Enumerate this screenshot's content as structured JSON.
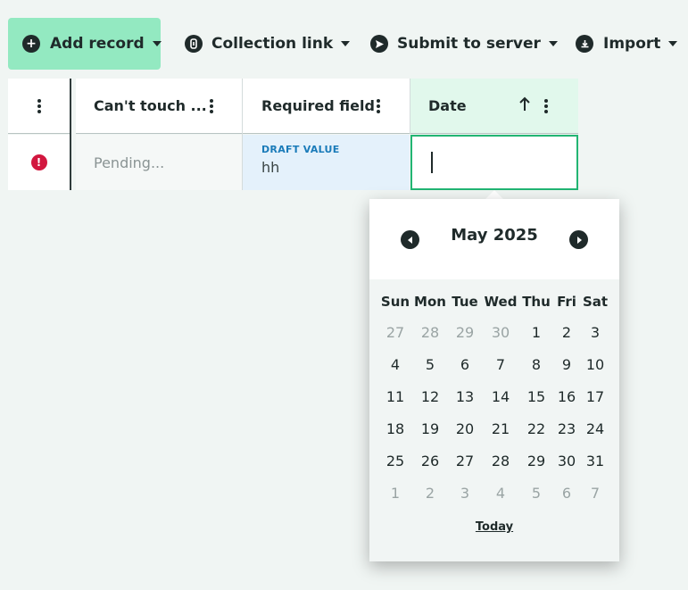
{
  "toolbar": {
    "add_record": {
      "label": "Add record",
      "icon": "plus-circle-icon"
    },
    "collection_link": {
      "label": "Collection link",
      "icon": "link-icon"
    },
    "submit": {
      "label": "Submit to server",
      "icon": "send-icon"
    },
    "import": {
      "label": "Import",
      "icon": "download-icon"
    }
  },
  "grid": {
    "columns": [
      {
        "label": "Can't touch ..."
      },
      {
        "label": "Required field"
      },
      {
        "label": "Date",
        "sort": "ascending"
      }
    ],
    "row": {
      "status_icon": "!",
      "cant_touch": "Pending...",
      "required": {
        "badge": "DRAFT VALUE",
        "value": "hh"
      },
      "date": {
        "value": ""
      }
    }
  },
  "calendar": {
    "month_label": "May 2025",
    "weekdays": [
      "Sun",
      "Mon",
      "Tue",
      "Wed",
      "Thu",
      "Fri",
      "Sat"
    ],
    "weeks": [
      [
        [
          "27",
          true
        ],
        [
          "28",
          true
        ],
        [
          "29",
          true
        ],
        [
          "30",
          true
        ],
        [
          "1",
          false
        ],
        [
          "2",
          false
        ],
        [
          "3",
          false
        ]
      ],
      [
        [
          "4",
          false
        ],
        [
          "5",
          false
        ],
        [
          "6",
          false
        ],
        [
          "7",
          false
        ],
        [
          "8",
          false
        ],
        [
          "9",
          false
        ],
        [
          "10",
          false
        ]
      ],
      [
        [
          "11",
          false
        ],
        [
          "12",
          false
        ],
        [
          "13",
          false
        ],
        [
          "14",
          false
        ],
        [
          "15",
          false
        ],
        [
          "16",
          false
        ],
        [
          "17",
          false
        ]
      ],
      [
        [
          "18",
          false
        ],
        [
          "19",
          false
        ],
        [
          "20",
          false
        ],
        [
          "21",
          false
        ],
        [
          "22",
          false
        ],
        [
          "23",
          false
        ],
        [
          "24",
          false
        ]
      ],
      [
        [
          "25",
          false
        ],
        [
          "26",
          false
        ],
        [
          "27",
          false
        ],
        [
          "28",
          false
        ],
        [
          "29",
          false
        ],
        [
          "30",
          false
        ],
        [
          "31",
          false
        ]
      ],
      [
        [
          "1",
          true
        ],
        [
          "2",
          true
        ],
        [
          "3",
          true
        ],
        [
          "4",
          true
        ],
        [
          "5",
          true
        ],
        [
          "6",
          true
        ],
        [
          "7",
          true
        ]
      ]
    ],
    "today_label": "Today"
  },
  "colors": {
    "accent": "#93e9c1",
    "active_border": "#22b573",
    "header_active_bg": "#e1f8ec",
    "draft_bg": "#e4f1fb",
    "draft_text": "#1a7bb9",
    "error": "#d2173f"
  }
}
